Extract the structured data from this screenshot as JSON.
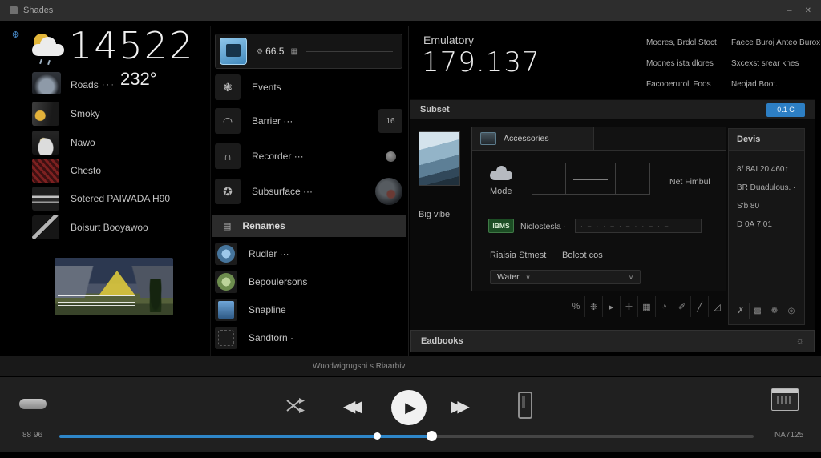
{
  "titlebar": {
    "title": "Shades",
    "minimize_glyph": "–",
    "close_glyph": "✕"
  },
  "colors": {
    "accent": "#2e86c8",
    "accent_button": "#2d7fc4",
    "badge_green": "#1c4d24"
  },
  "left_panel": {
    "bluetooth_glyph": "❆",
    "clock_value": "14522",
    "row_label": "Roads",
    "row_dots": "···",
    "temperature": "232°",
    "items": [
      {
        "label": "Smoky"
      },
      {
        "label": "Nawo"
      },
      {
        "label": "Chesto"
      },
      {
        "label": "Sotered PAIWADA H90"
      },
      {
        "label": "Boisurt Booyawoo"
      }
    ]
  },
  "middle_panel": {
    "selected": {
      "prefix_glyph": "⚙",
      "value": "66.5",
      "grid_glyph": "▦"
    },
    "items": [
      {
        "icon_glyph": "❃",
        "label": "Events"
      },
      {
        "icon_glyph": "◠",
        "label": "Barrier ···",
        "badge": "16"
      },
      {
        "icon_glyph": "∩",
        "label": "Recorder ···"
      },
      {
        "icon_glyph": "✪",
        "label": "Subsurface ···"
      }
    ],
    "section": {
      "icon_glyph": "▤",
      "label": "Renames"
    },
    "rename_items": [
      {
        "label": "Rudler ···"
      },
      {
        "label": "Bepoulersons"
      },
      {
        "label": "Snapline"
      },
      {
        "label": "Sandtorn ·"
      }
    ]
  },
  "right_panel": {
    "title": "Emulatory",
    "big_value": "179.137",
    "links": [
      "Moores, Brdol Stoct",
      "Faece Buroj Anteo Burox",
      "Moones ista dlores",
      "Sxcexst srear knes",
      "Facooeruroll Foos",
      "Neojad Boot."
    ],
    "subset": {
      "label": "Subset",
      "button_label": "0.1 C"
    },
    "viewer_caption": "Big vibe",
    "dialog": {
      "tab_label": "Accessories",
      "mode_label": "Mode",
      "mode_note": "Net Fimbul",
      "badge": "IBMS",
      "field_label": "Niclostesla ·",
      "field_value": "· – · · – · – · · – · –",
      "label_a": "Riaisia Stmest",
      "label_b": "Bolcot cos",
      "select_label": "Water",
      "chevron": "∨"
    },
    "toolbar_icons": [
      {
        "name": "percent",
        "glyph": "%"
      },
      {
        "name": "flower",
        "glyph": "❉"
      },
      {
        "name": "play",
        "glyph": "▸"
      },
      {
        "name": "plus",
        "glyph": "✛"
      },
      {
        "name": "grid",
        "glyph": "▦"
      },
      {
        "name": "clock",
        "glyph": "◔"
      },
      {
        "name": "pencil",
        "glyph": "✐"
      },
      {
        "name": "slash",
        "glyph": "╱"
      },
      {
        "name": "chart",
        "glyph": "◿"
      }
    ],
    "details": {
      "title": "Devis",
      "lines": [
        "8/ 8AI 20 460↑",
        "BR Duadulous. ·",
        "S'b 80",
        "D 0A 7.01"
      ],
      "footer_icons": [
        {
          "name": "close",
          "glyph": "✗"
        },
        {
          "name": "grid",
          "glyph": "▩"
        },
        {
          "name": "flower",
          "glyph": "❁"
        },
        {
          "name": "circle",
          "glyph": "◎"
        }
      ]
    },
    "emotions_bar": {
      "label": "Eadbooks",
      "icon_glyph": "☼"
    }
  },
  "status_bar": {
    "text": "Wuodwigrugshi s Riaarbiv"
  },
  "player": {
    "time_left": "88 96",
    "time_right": "NA7125",
    "rewind_glyph": "◀◀",
    "play_glyph": "▶",
    "forward_glyph": "▶▶",
    "progress": {
      "fill_pct": 53.6,
      "marker_pct": 45.7
    }
  }
}
